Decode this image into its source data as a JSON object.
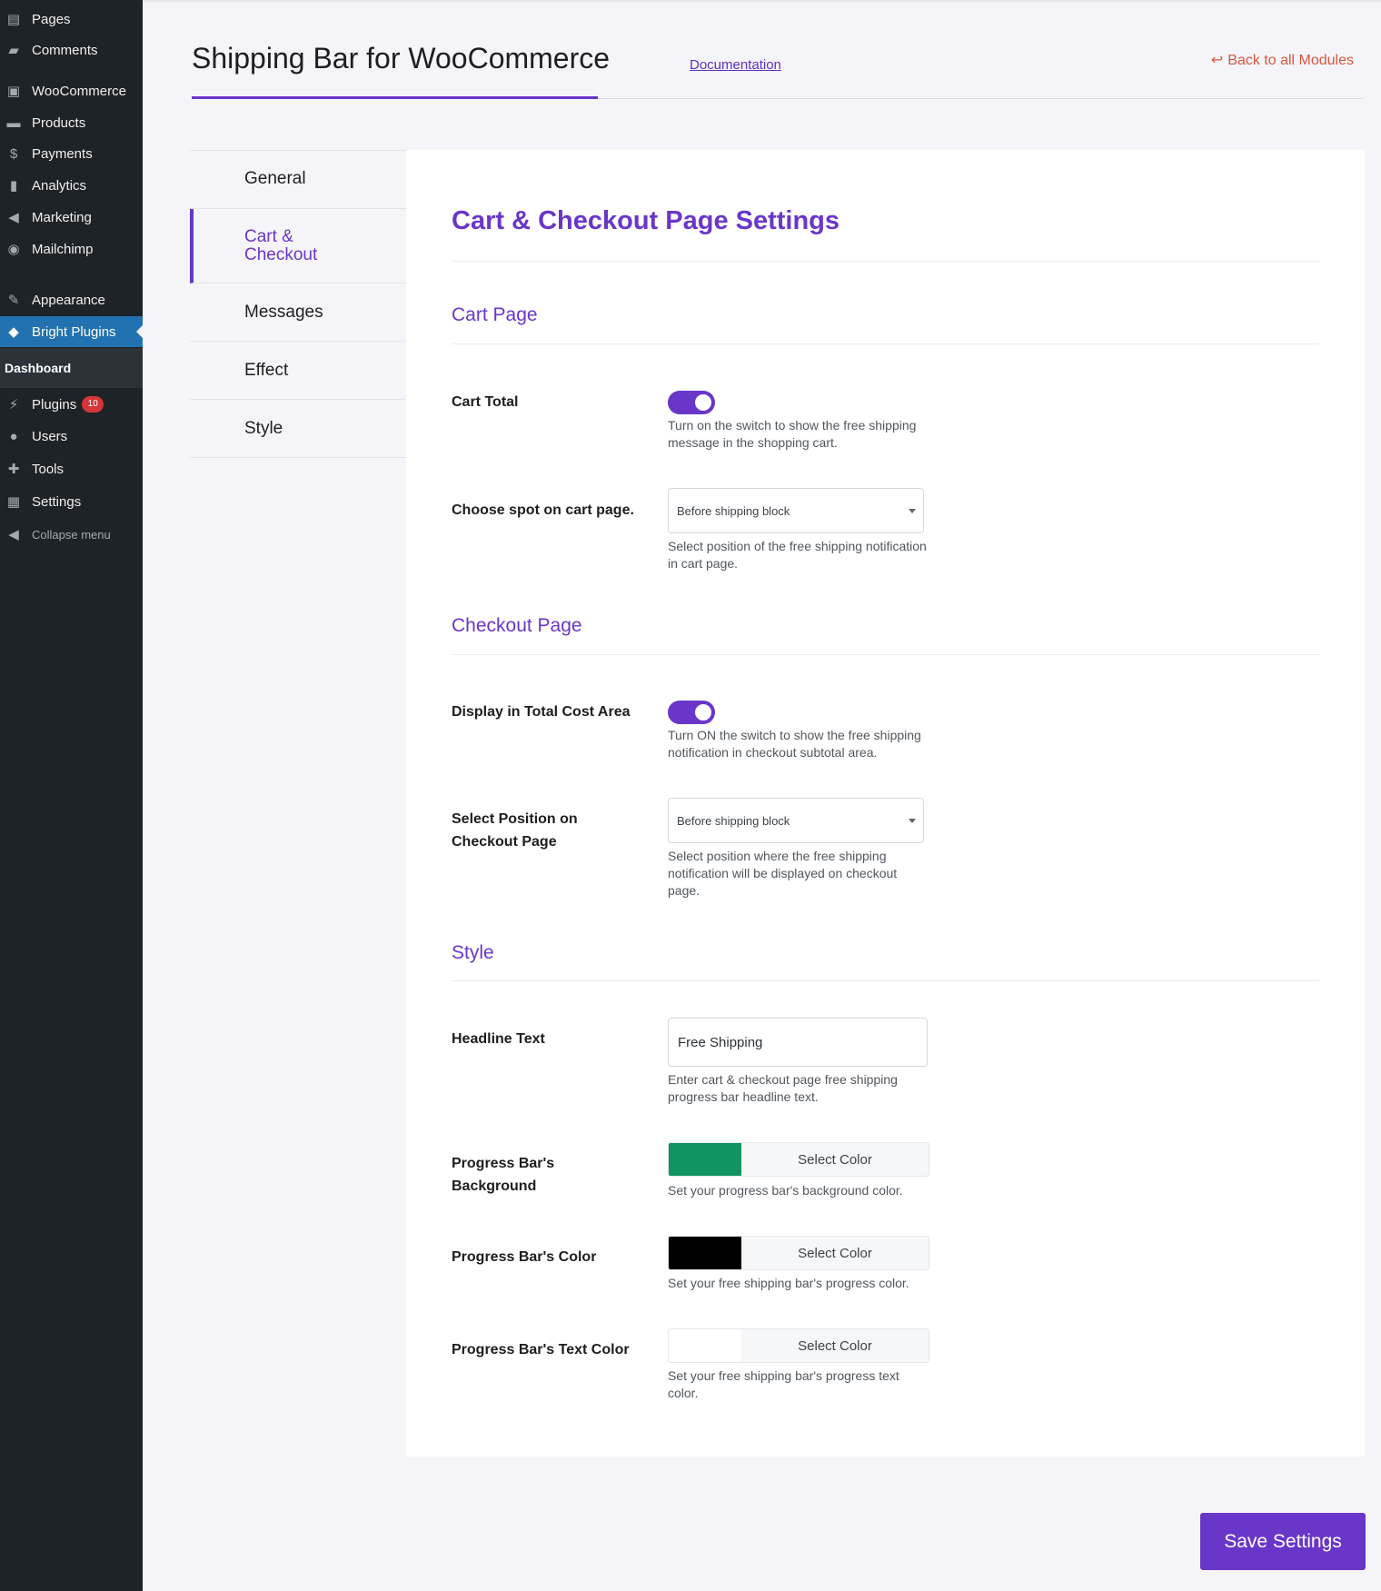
{
  "sidebar": {
    "items": [
      {
        "label": "Pages",
        "icon": "pages-icon",
        "glyph": "▤"
      },
      {
        "label": "Comments",
        "icon": "comments-icon",
        "glyph": "▰"
      },
      {
        "label": "WooCommerce",
        "icon": "woocommerce-icon",
        "glyph": "▣"
      },
      {
        "label": "Products",
        "icon": "products-icon",
        "glyph": "▬"
      },
      {
        "label": "Payments",
        "icon": "payments-icon",
        "glyph": "$"
      },
      {
        "label": "Analytics",
        "icon": "analytics-icon",
        "glyph": "▮"
      },
      {
        "label": "Marketing",
        "icon": "marketing-icon",
        "glyph": "◀"
      },
      {
        "label": "Mailchimp",
        "icon": "mailchimp-icon",
        "glyph": "◉"
      },
      {
        "label": "Appearance",
        "icon": "appearance-icon",
        "glyph": "✎"
      },
      {
        "label": "Bright Plugins",
        "icon": "bright-plugins-icon",
        "glyph": "◆"
      },
      {
        "label": "Plugins",
        "icon": "plugins-icon",
        "glyph": "⚡",
        "badge": "10"
      },
      {
        "label": "Users",
        "icon": "users-icon",
        "glyph": "●"
      },
      {
        "label": "Tools",
        "icon": "tools-icon",
        "glyph": "✚"
      },
      {
        "label": "Settings",
        "icon": "settings-icon",
        "glyph": "▦"
      },
      {
        "label": "Collapse menu",
        "icon": "collapse-icon",
        "glyph": "◀"
      }
    ],
    "submenu_label": "Dashboard",
    "active_item": "Bright Plugins"
  },
  "header": {
    "title": "Shipping Bar for WooCommerce",
    "documentation_link": "Documentation",
    "back_link": "Back to all Modules",
    "back_icon": "reply-arrow-icon"
  },
  "tabs": [
    {
      "label": "General",
      "active": false
    },
    {
      "label": "Cart & Checkout",
      "active": true
    },
    {
      "label": "Messages",
      "active": false
    },
    {
      "label": "Effect",
      "active": false
    },
    {
      "label": "Style",
      "active": false
    }
  ],
  "panel": {
    "title": "Cart & Checkout Page Settings",
    "cart_section": {
      "title": "Cart Page",
      "cart_total": {
        "label": "Cart Total",
        "enabled": true,
        "description": "Turn on the switch to show the free shipping message in the shopping cart."
      },
      "cart_spot": {
        "label": "Choose spot on cart page.",
        "value": "Before shipping block",
        "description": "Select position of the free shipping notification in cart page."
      }
    },
    "checkout_section": {
      "title": "Checkout Page",
      "total_cost_area": {
        "label": "Display in Total Cost Area",
        "enabled": true,
        "description": "Turn ON the switch to show the free shipping notification in checkout subtotal area."
      },
      "checkout_position": {
        "label": "Select Position on Checkout Page",
        "value": "Before shipping block",
        "description": "Select position where the free shipping notification will be displayed on checkout page."
      }
    },
    "style_section": {
      "title": "Style",
      "headline_text": {
        "label": "Headline Text",
        "value": "Free Shipping",
        "description": "Enter cart & checkout page free shipping progress bar headline text."
      },
      "bar_background": {
        "label": "Progress Bar's Background",
        "color": "#129460",
        "button": "Select Color",
        "description": "Set your progress bar's background color."
      },
      "bar_color": {
        "label": "Progress Bar's Color",
        "color": "#000000",
        "button": "Select Color",
        "description": "Set your free shipping bar's progress color."
      },
      "bar_text_color": {
        "label": "Progress Bar's Text Color",
        "color": "#ffffff",
        "button": "Select Color",
        "description": "Set your free shipping bar's progress text color."
      }
    }
  },
  "save_button": "Save Settings",
  "colors": {
    "accent": "#6a36c9",
    "sidebar_bg": "#1e2327",
    "sidebar_active": "#2271b1",
    "back_link": "#d9553f",
    "badge": "#d63638"
  }
}
